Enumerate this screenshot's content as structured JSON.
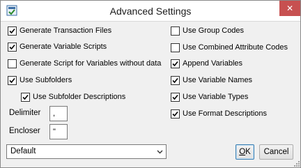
{
  "window": {
    "title": "Advanced Settings",
    "close_glyph": "✕"
  },
  "left_checkboxes": [
    {
      "label": "Generate Transaction Files",
      "checked": true
    },
    {
      "label": "Generate Variable Scripts",
      "checked": true
    },
    {
      "label": "Generate Script for Variables without data",
      "checked": false
    },
    {
      "label": "Use Subfolders",
      "checked": true
    },
    {
      "label": "Use Subfolder Descriptions",
      "checked": true
    }
  ],
  "right_checkboxes": [
    {
      "label": "Use Group Codes",
      "checked": false
    },
    {
      "label": "Use Combined Attribute Codes",
      "checked": false
    },
    {
      "label": "Append Variables",
      "checked": true
    },
    {
      "label": "Use Variable Names",
      "checked": true
    },
    {
      "label": "Use Variable Types",
      "checked": true
    },
    {
      "label": "Use Format Descriptions",
      "checked": true
    }
  ],
  "delimiter": {
    "label": "Delimiter",
    "value": ","
  },
  "encloser": {
    "label": "Encloser",
    "value": "\""
  },
  "format_select": {
    "value": "Default"
  },
  "buttons": {
    "ok_hotkey": "O",
    "ok_rest": "K",
    "cancel": "Cancel"
  },
  "icons": {
    "app": "app-settings-icon",
    "close": "close-icon",
    "dropdown": "chevron-down-icon",
    "check": "check-icon"
  }
}
